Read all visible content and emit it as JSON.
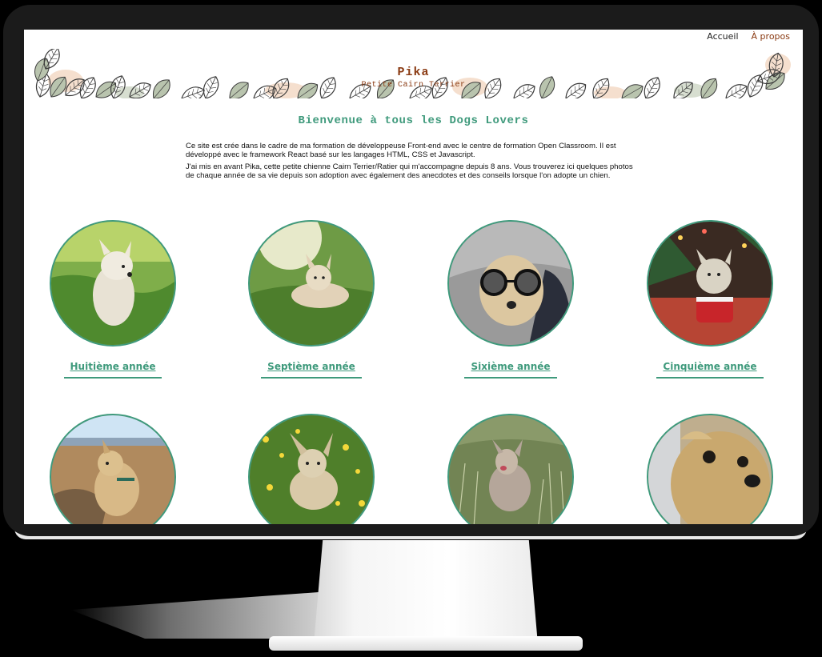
{
  "nav": {
    "home_label": "Accueil",
    "about_label": "À propos"
  },
  "header": {
    "title": "Pika",
    "subtitle": "Petite Cairn Terrier"
  },
  "main": {
    "welcome_title": "Bienvenue à tous les Dogs Lovers",
    "intro_p1": "Ce site est crée dans le cadre de ma formation de développeuse Front-end avec le centre de formation Open Classroom. Il est développé avec le framework React basé sur les langages HTML, CSS et Javascript.",
    "intro_p2": "J'ai mis en avant Pika, cette petite chienne Cairn Terrier/Ratier qui m'accompagne depuis 8 ans. Vous trouverez ici quelques photos de chaque année de sa vie depuis son adoption avec également des anecdotes et des conseils lorsque l'on adopte un chien."
  },
  "gallery": {
    "items": [
      {
        "label": "Huitième année"
      },
      {
        "label": "Septième année"
      },
      {
        "label": "Sixième année"
      },
      {
        "label": "Cinquième année"
      },
      {
        "label": ""
      },
      {
        "label": ""
      },
      {
        "label": ""
      },
      {
        "label": ""
      }
    ]
  },
  "colors": {
    "accent": "#3f9a7c",
    "brand": "#8a3a12"
  }
}
